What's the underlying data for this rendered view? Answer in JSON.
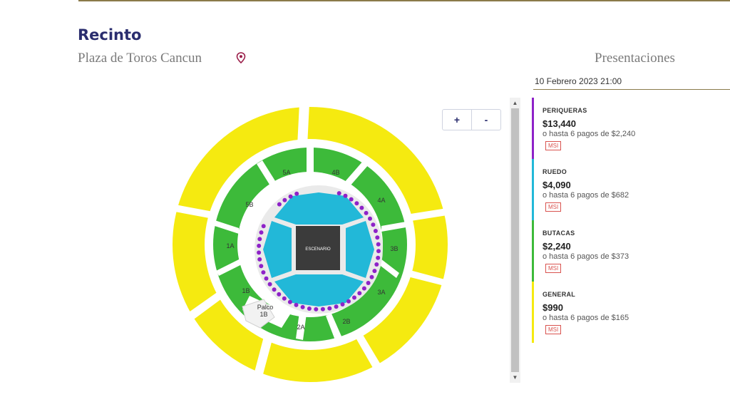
{
  "header": {
    "title": "Recinto",
    "venue": "Plaza de Toros Cancun",
    "venue_icon": "map-pin-icon",
    "presentations_label": "Presentaciones"
  },
  "presentation": {
    "date": "10 Febrero 2023 21:00"
  },
  "zoom": {
    "in_label": "+",
    "out_label": "-"
  },
  "scroll": {
    "up_icon": "▲",
    "down_icon": "▼"
  },
  "map": {
    "stage_label": "ESCENARIO",
    "sections": {
      "s5a": "5A",
      "s4b": "4B",
      "s4a": "4A",
      "s5b": "5B",
      "s1a": "1A",
      "s3b": "3B",
      "s1b": "1B",
      "s3a": "3A",
      "s2a": "2A",
      "s2b": "2B",
      "palco_line1": "Palco",
      "palco_line2": "1B"
    },
    "colors": {
      "general": "#f5ea10",
      "butacas": "#3dba3a",
      "ruedo": "#22b8d8",
      "periqueras": "#8e22c8",
      "stage": "#3b3b3b"
    }
  },
  "categories": [
    {
      "name": "PERIQUERAS",
      "price": "$13,440",
      "payments": "o hasta 6 pagos de $2,240",
      "badge": "MSI",
      "color": "#8e22c8"
    },
    {
      "name": "RUEDO",
      "price": "$4,090",
      "payments": "o hasta 6 pagos de $682",
      "badge": "MSI",
      "color": "#22b8d8"
    },
    {
      "name": "BUTACAS",
      "price": "$2,240",
      "payments": "o hasta 6 pagos de $373",
      "badge": "MSI",
      "color": "#3dba3a"
    },
    {
      "name": "GENERAL",
      "price": "$990",
      "payments": "o hasta 6 pagos de $165",
      "badge": "MSI",
      "color": "#f5ea10"
    }
  ]
}
